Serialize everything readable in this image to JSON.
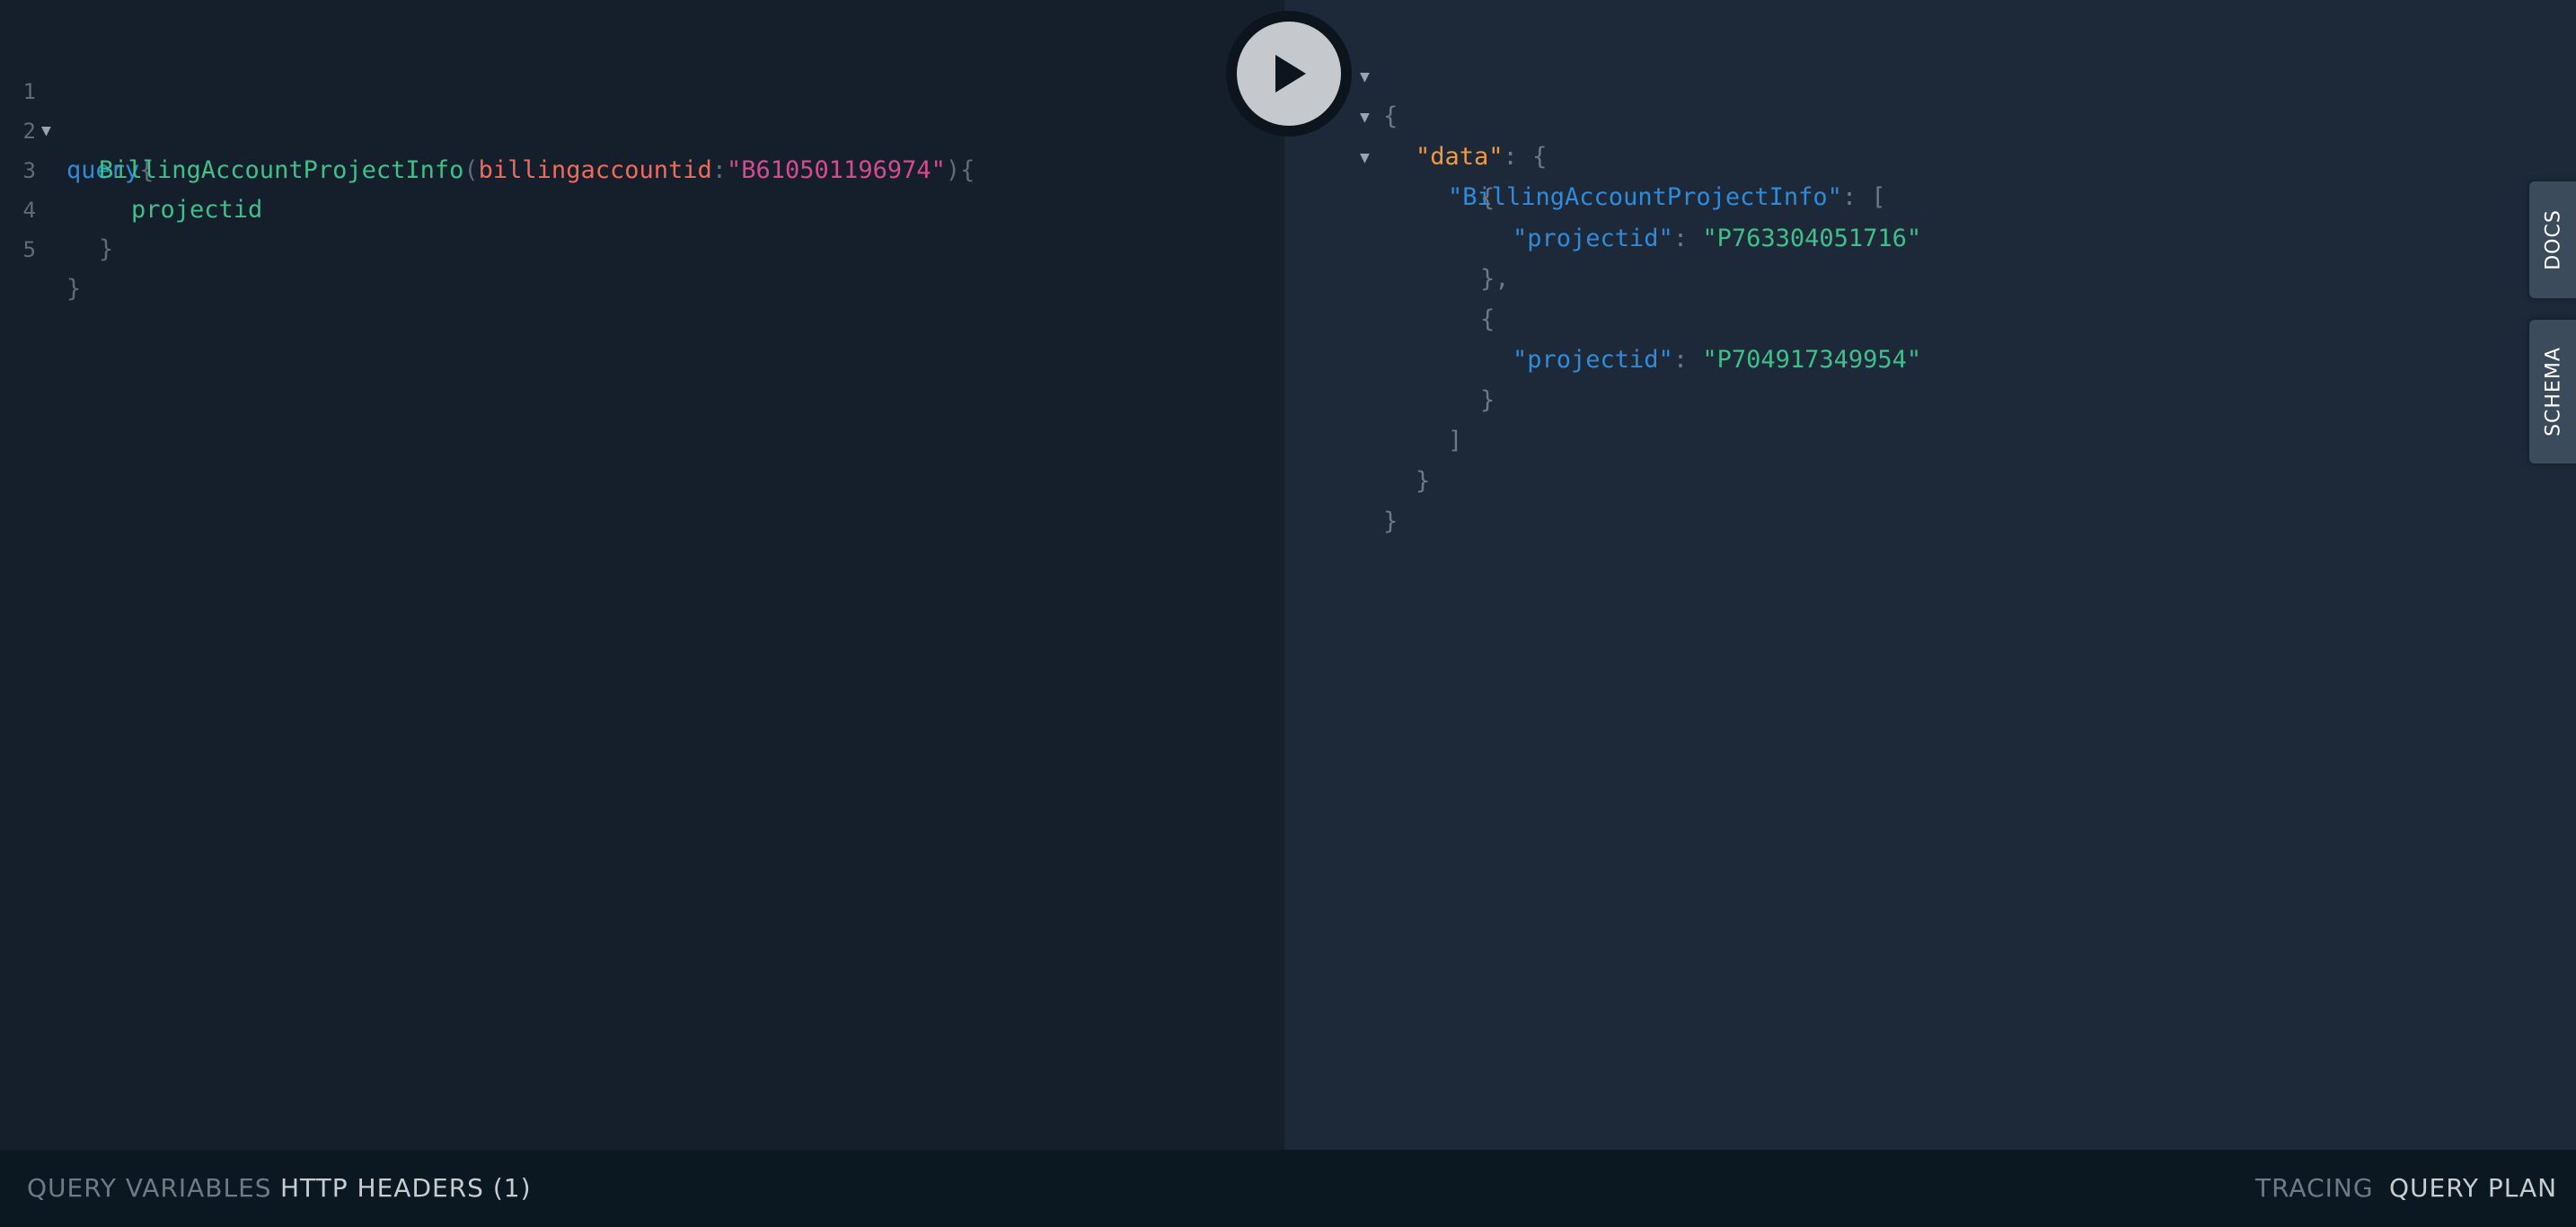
{
  "editor": {
    "lines": [
      {
        "num": "1",
        "tokens": [
          "query",
          "{"
        ]
      },
      {
        "num": "2",
        "tokens": [
          "BillingAccountProjectInfo",
          "(",
          "billingaccountid",
          ":",
          "\"B610501196974\"",
          "){"
        ]
      },
      {
        "num": "3",
        "tokens": [
          "projectid"
        ]
      },
      {
        "num": "4",
        "tokens": [
          "}"
        ]
      },
      {
        "num": "5",
        "tokens": [
          "}"
        ]
      }
    ]
  },
  "run_button": {
    "icon": "play-icon"
  },
  "result": {
    "open_brace": "{",
    "data_key": "\"data\"",
    "colon_sep": ": ",
    "data_open": "{",
    "info_key": "\"BillingAccountProjectInfo\"",
    "info_open": "[",
    "items": [
      {
        "open": "{",
        "key": "\"projectid\"",
        "value": "\"P763304051716\"",
        "close": "},"
      },
      {
        "open": "{",
        "key": "\"projectid\"",
        "value": "\"P704917349954\"",
        "close": "}"
      }
    ],
    "info_close": "]",
    "data_close": "}",
    "close_brace": "}"
  },
  "side_tabs": {
    "docs": "DOCS",
    "schema": "SCHEMA"
  },
  "bottom_bar": {
    "query_variables": "QUERY VARIABLES",
    "http_headers": "HTTP HEADERS (1)",
    "tracing": "TRACING",
    "query_plan": "QUERY PLAN"
  },
  "colors": {
    "editor_bg": "#141f2b",
    "result_bg": "#1d2939",
    "bottom_bg": "#0c1821",
    "keyword": "#2f8bd9",
    "field": "#3fbf8a",
    "argument": "#f06a5c",
    "string": "#d54a90",
    "json_key_orange": "#ef9a3c"
  }
}
